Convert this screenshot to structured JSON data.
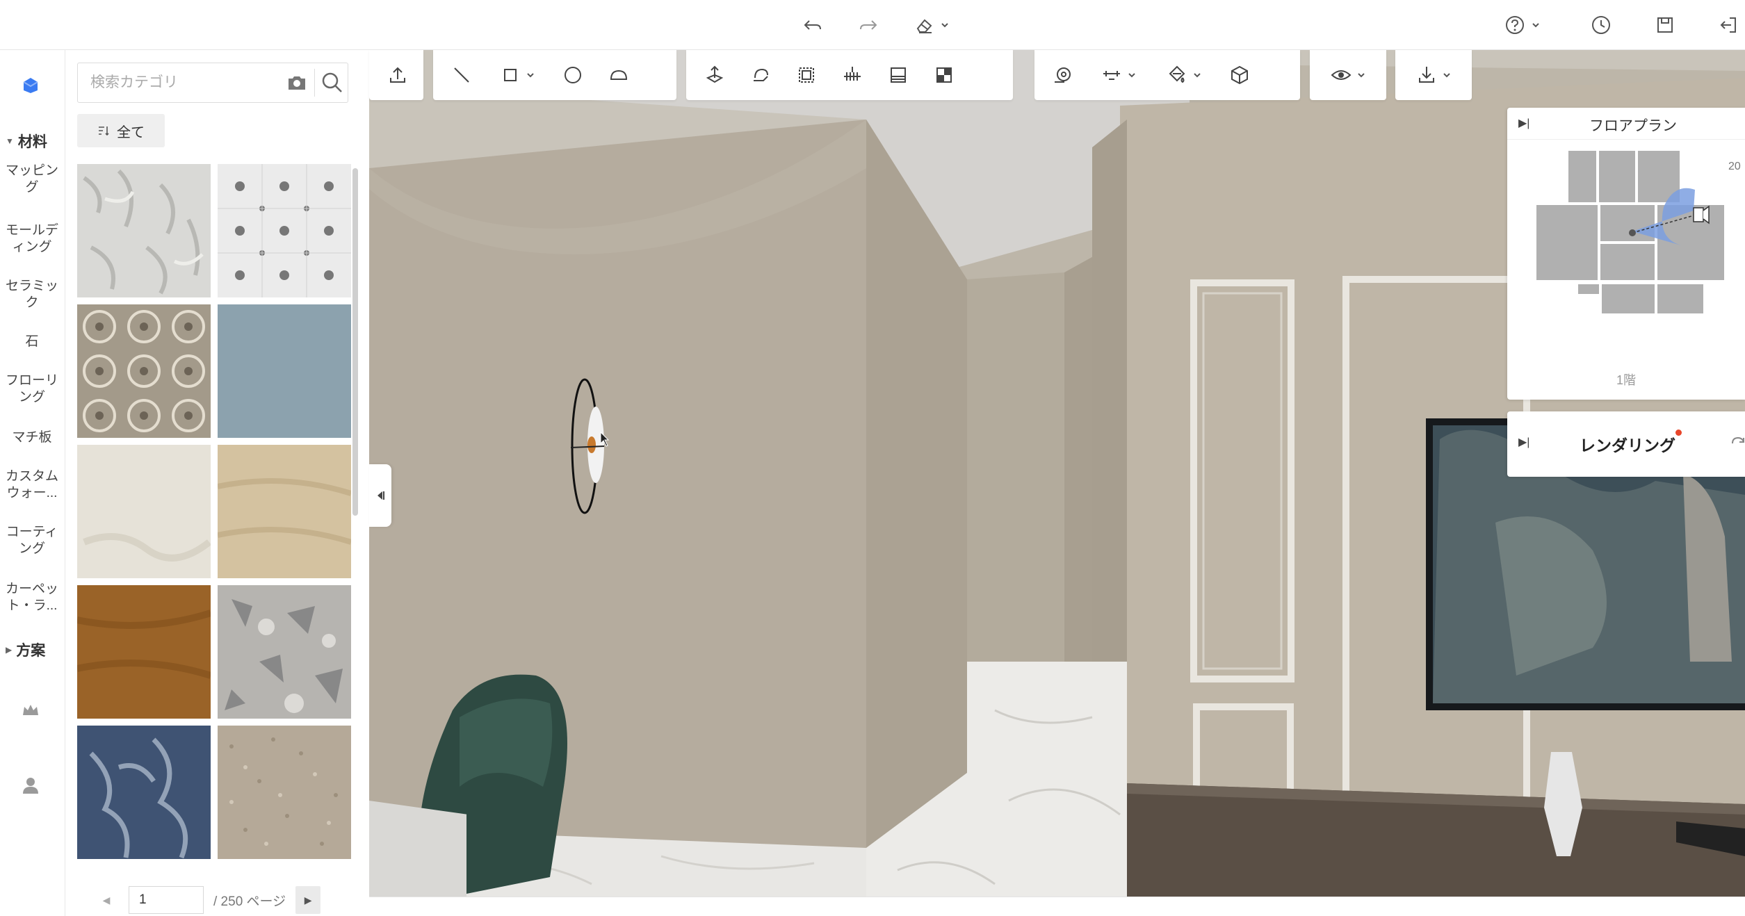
{
  "topbar": {
    "undo_icon": "undo-icon",
    "redo_icon": "redo-icon",
    "eraser_icon": "eraser-icon",
    "help_icon": "help-icon",
    "history_icon": "clock-icon",
    "save_icon": "save-icon",
    "exit_icon": "exit-icon"
  },
  "rail": {
    "groups": [
      {
        "label": "材料",
        "expanded": true
      },
      {
        "label": "方案",
        "expanded": false
      }
    ],
    "items": [
      {
        "label": "マッピング"
      },
      {
        "label": "モールディング"
      },
      {
        "label": "セラミック"
      },
      {
        "label": "石"
      },
      {
        "label": "フローリング"
      },
      {
        "label": "マチ板"
      },
      {
        "label": "カスタムウォー..."
      },
      {
        "label": "コーティング"
      },
      {
        "label": "カーペット・ラ..."
      }
    ],
    "crown_icon": "crown-icon",
    "user_icon": "user-icon"
  },
  "materials": {
    "search_placeholder": "検索カテゴリ",
    "filter_label": "全て",
    "tiles": [
      {
        "name": "white-leaf-marble",
        "color": "#d9d9d6"
      },
      {
        "name": "grey-star-tile",
        "color": "#e9e9e9"
      },
      {
        "name": "floral-encaustic-tile",
        "color": "#a39a8a"
      },
      {
        "name": "blue-grey-plain",
        "color": "#8ca2ae"
      },
      {
        "name": "cream-plaster",
        "color": "#e6e2d8"
      },
      {
        "name": "sand-travertine",
        "color": "#d4c2a0"
      },
      {
        "name": "ochre-wood",
        "color": "#9a6328"
      },
      {
        "name": "grey-terrazzo",
        "color": "#b6b4b0"
      },
      {
        "name": "navy-ink-marble",
        "color": "#3f5373"
      },
      {
        "name": "beige-granite",
        "color": "#b5a998"
      }
    ],
    "pager": {
      "current_page": "1",
      "total_label": "/ 250 ページ"
    }
  },
  "floorplan": {
    "title": "フロアプラン",
    "floor_label": "1階",
    "side_number": "20"
  },
  "rendering": {
    "title": "レンダリング"
  },
  "colors": {
    "accent_blue": "#3a7bf2",
    "wall": "#b4ab9c",
    "floor": "#ecebe8",
    "notification": "#e8462a"
  }
}
